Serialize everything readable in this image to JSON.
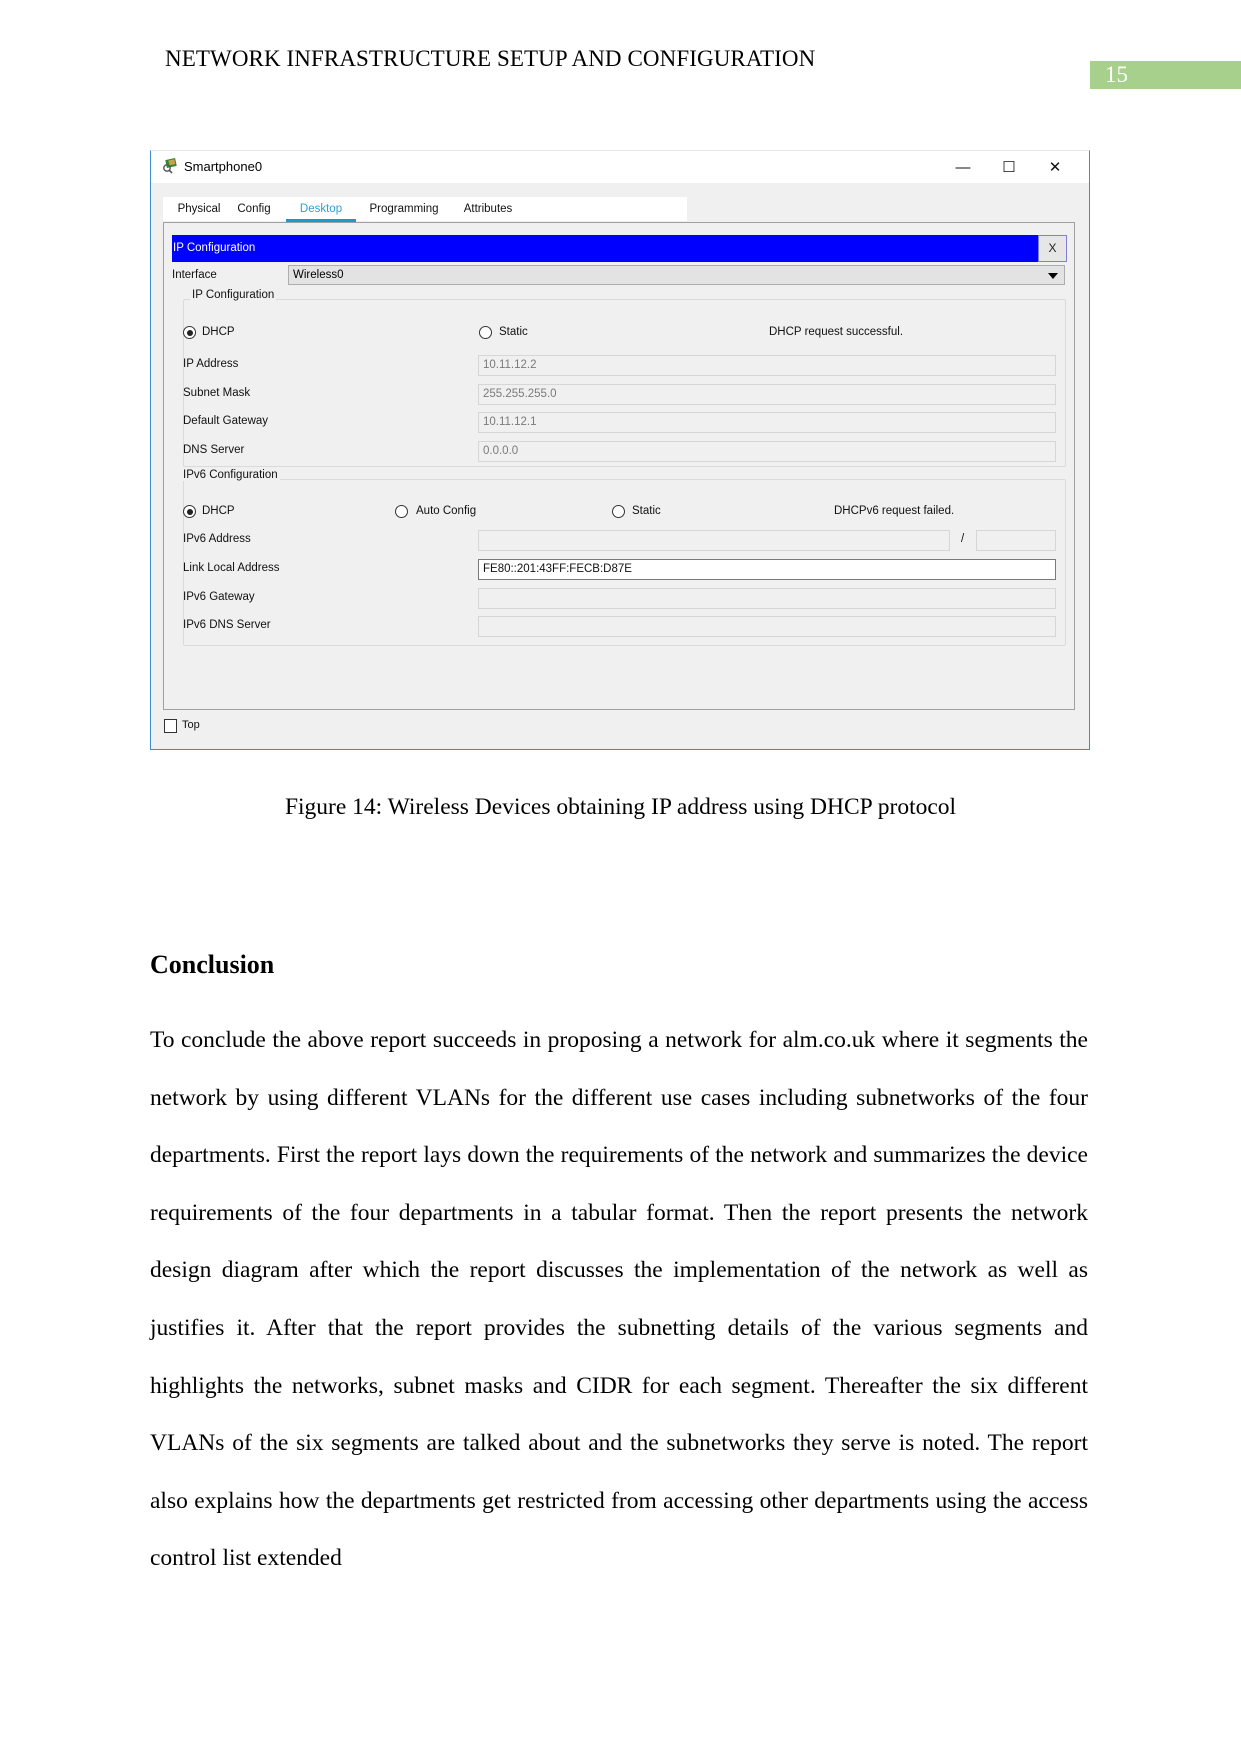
{
  "header": {
    "running_title": "NETWORK INFRASTRUCTURE SETUP AND CONFIGURATION",
    "page_number": "15",
    "page_number_color": "#a8d08d"
  },
  "dialog": {
    "title": "Smartphone0",
    "icon": "smartphone-device-icon",
    "window_controls": {
      "minimize": "—",
      "maximize": "☐",
      "close": "✕"
    },
    "tabs": [
      {
        "label": "Physical",
        "active": false
      },
      {
        "label": "Config",
        "active": false
      },
      {
        "label": "Desktop",
        "active": true
      },
      {
        "label": "Programming",
        "active": false
      },
      {
        "label": "Attributes",
        "active": false
      }
    ],
    "panel": {
      "title": "IP Configuration",
      "title_bar_color": "#0000ff",
      "close_label": "X",
      "interface_label": "Interface",
      "interface_value": "Wireless0",
      "ipv4": {
        "legend": "IP Configuration",
        "mode_dhcp": "DHCP",
        "mode_static": "Static",
        "selected_mode": "DHCP",
        "status": "DHCP request successful.",
        "fields": [
          {
            "label": "IP Address",
            "value": "10.11.12.2"
          },
          {
            "label": "Subnet Mask",
            "value": "255.255.255.0"
          },
          {
            "label": "Default Gateway",
            "value": "10.11.12.1"
          },
          {
            "label": "DNS Server",
            "value": "0.0.0.0"
          }
        ]
      },
      "ipv6": {
        "legend": "IPv6 Configuration",
        "mode_dhcp": "DHCP",
        "mode_auto": "Auto Config",
        "mode_static": "Static",
        "selected_mode": "DHCP",
        "status": "DHCPv6 request failed.",
        "prefix_separator": "/",
        "fields": [
          {
            "label": "IPv6 Address",
            "value": "",
            "prefix": ""
          },
          {
            "label": "Link Local Address",
            "value": "FE80::201:43FF:FECB:D87E"
          },
          {
            "label": "IPv6 Gateway",
            "value": ""
          },
          {
            "label": "IPv6 DNS Server",
            "value": ""
          }
        ]
      }
    },
    "top_checkbox_label": "Top",
    "top_checked": false
  },
  "figure_caption": "Figure 14: Wireless Devices obtaining IP address using DHCP protocol",
  "section": {
    "heading": "Conclusion",
    "paragraph": "To conclude the above report succeeds in proposing a network for alm.co.uk where it segments the network by using different VLANs for the different use cases including subnetworks of the four departments. First the report lays down the requirements of the network and summarizes the device requirements of the four departments in a tabular format. Then the report presents the network design diagram after which the report discusses the implementation of the network as well as justifies it. After that the report provides the subnetting details of the various segments and highlights the networks, subnet masks and CIDR for each segment. Thereafter the six different VLANs of the six segments are talked about and the subnetworks they serve is noted. The report also explains how the departments get restricted from accessing other departments using the access control list extended"
  }
}
